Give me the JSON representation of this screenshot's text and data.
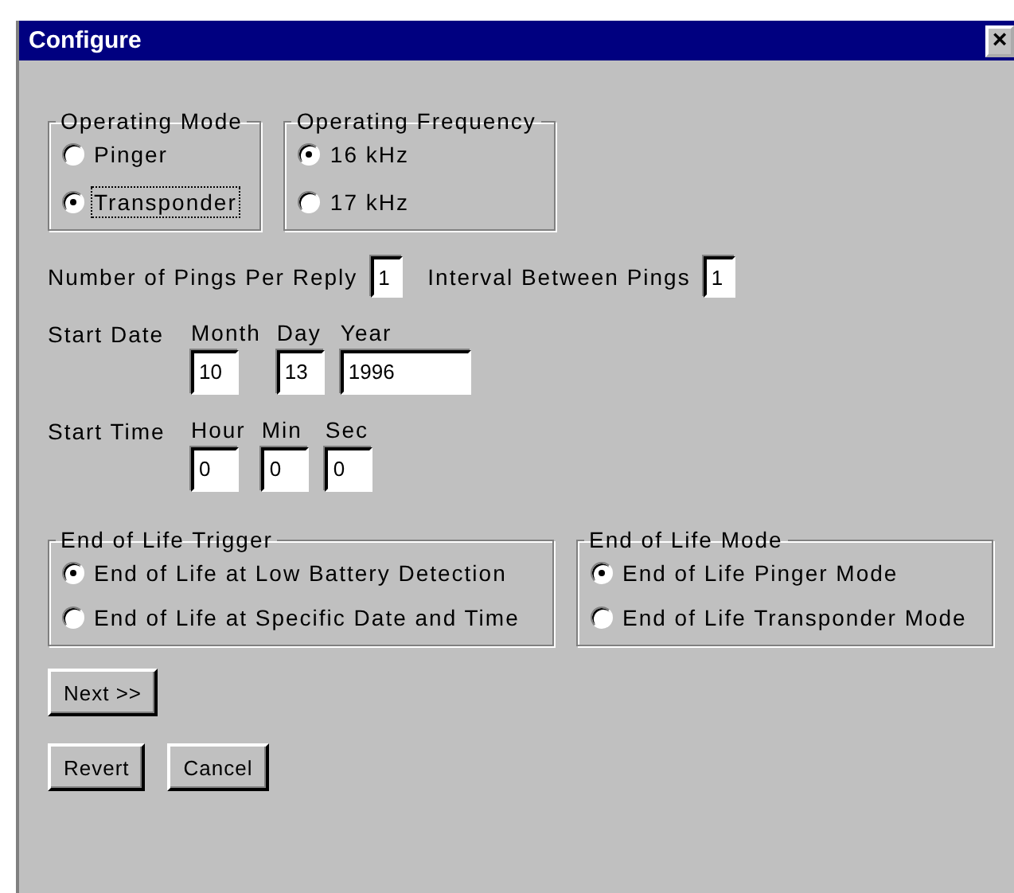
{
  "window": {
    "title": "Configure",
    "close": "×"
  },
  "operating_mode": {
    "label": "Operating Mode",
    "options": [
      {
        "label": "Pinger",
        "selected": false,
        "focused": false
      },
      {
        "label": "Transponder",
        "selected": true,
        "focused": true
      }
    ]
  },
  "operating_frequency": {
    "label": "Operating Frequency",
    "options": [
      {
        "label": "16 kHz",
        "selected": true
      },
      {
        "label": "17 kHz",
        "selected": false
      }
    ]
  },
  "pings_per_reply": {
    "label": "Number of Pings Per Reply",
    "value": "1"
  },
  "interval_between_pings": {
    "label": "Interval Between Pings",
    "value": "1"
  },
  "start_date": {
    "label": "Start Date",
    "fields": [
      {
        "label": "Month",
        "value": "10",
        "kind": "short"
      },
      {
        "label": "Day",
        "value": "13",
        "kind": "short"
      },
      {
        "label": "Year",
        "value": "1996",
        "kind": "long"
      }
    ]
  },
  "start_time": {
    "label": "Start Time",
    "fields": [
      {
        "label": "Hour",
        "value": "0",
        "kind": "short"
      },
      {
        "label": "Min",
        "value": "0",
        "kind": "short"
      },
      {
        "label": "Sec",
        "value": "0",
        "kind": "short"
      }
    ]
  },
  "end_of_life_trigger": {
    "label": "End of Life Trigger",
    "options": [
      {
        "label": "End of Life at Low Battery Detection",
        "selected": true
      },
      {
        "label": "End of Life at Specific Date and Time",
        "selected": false
      }
    ]
  },
  "end_of_life_mode": {
    "label": "End of Life Mode",
    "options": [
      {
        "label": "End of Life Pinger Mode",
        "selected": true
      },
      {
        "label": "End of Life Transponder Mode",
        "selected": false
      }
    ]
  },
  "next_button": "Next >>",
  "buttons": [
    "Revert",
    "Cancel"
  ]
}
